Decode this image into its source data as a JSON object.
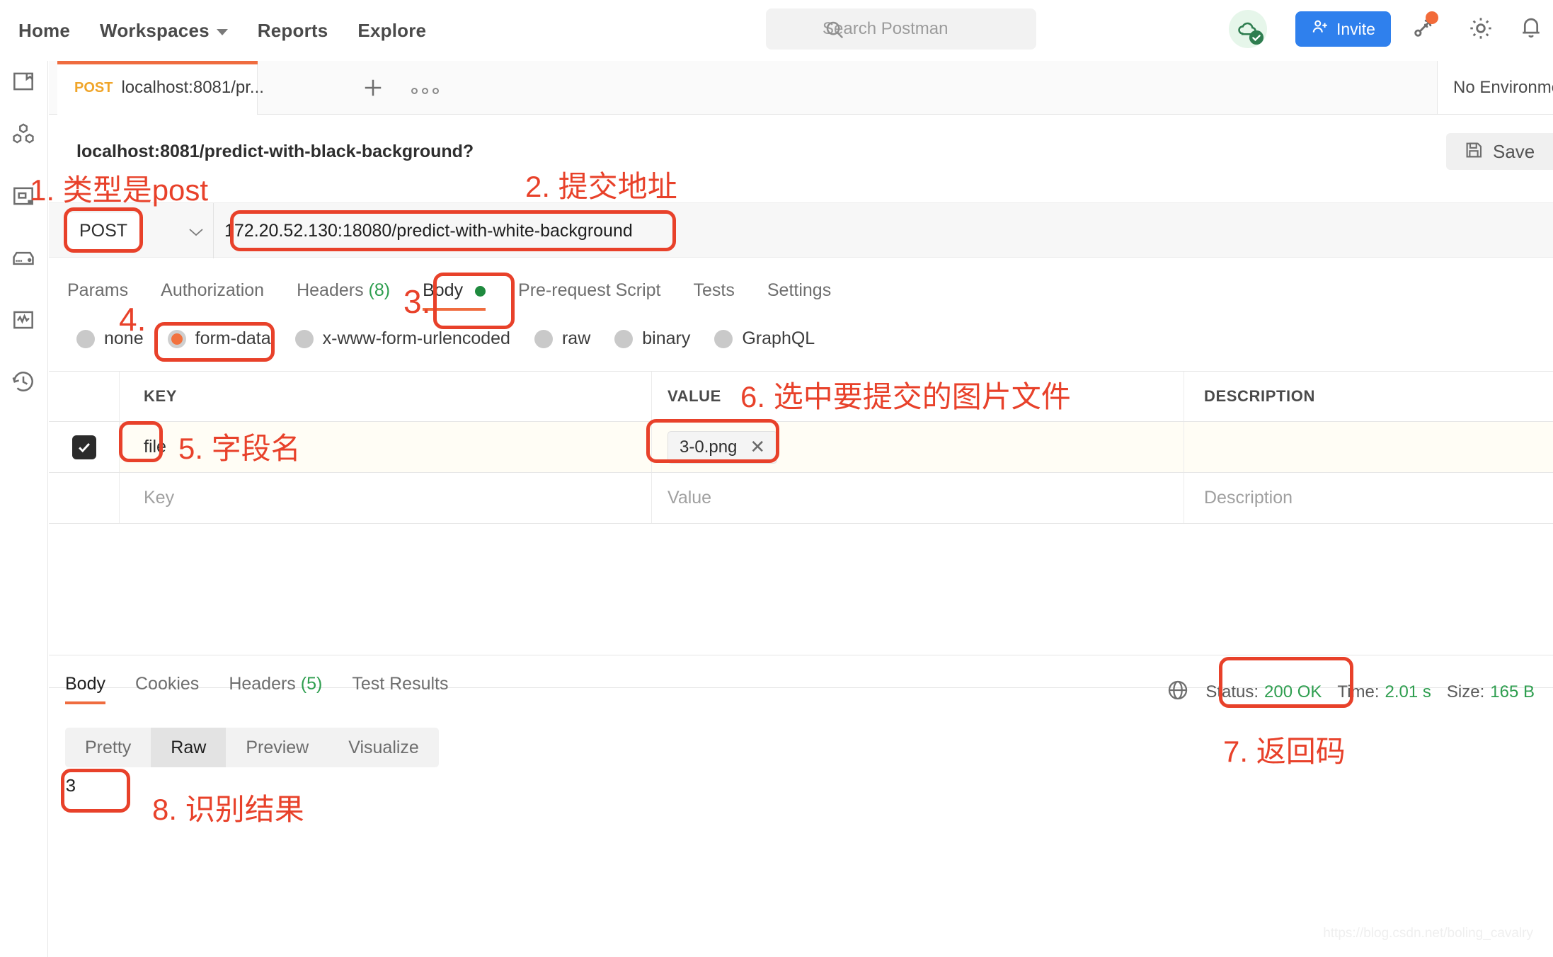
{
  "app": {
    "name": "Postman"
  },
  "header": {
    "nav": [
      {
        "label": "Home",
        "icon": "home-item"
      },
      {
        "label": "Workspaces",
        "icon": "chevron-down-icon"
      },
      {
        "label": "Reports",
        "icon": "reports-item"
      },
      {
        "label": "Explore",
        "icon": "explore-item"
      }
    ],
    "search": {
      "placeholder": "Search Postman",
      "icon": "search-icon"
    },
    "cloud_icon": "cloud-sync-ok-icon",
    "invite": {
      "label": "Invite",
      "icon": "person-add-icon",
      "color": "#2f80ed"
    },
    "broadcast_icon": "broadcast-icon",
    "settings_icon": "gear-icon",
    "notifications_icon": "bell-icon"
  },
  "sidebar": {
    "items": [
      {
        "name": "collections",
        "icon": "collections-folder-icon"
      },
      {
        "name": "apis",
        "icon": "apis-hexagons-icon"
      },
      {
        "name": "environments",
        "icon": "environments-box-icon"
      },
      {
        "name": "mock-servers",
        "icon": "mock-server-icon"
      },
      {
        "name": "monitors",
        "icon": "monitor-pulse-icon"
      },
      {
        "name": "history",
        "icon": "history-clock-icon"
      }
    ]
  },
  "tabstrip": {
    "tab": {
      "method": "POST",
      "title": "localhost:8081/pr...",
      "dirty": true
    },
    "new_tab_icon": "plus-icon",
    "more_icon": "more-horizontal-icon",
    "environment_selector": "No Environme"
  },
  "request": {
    "breadcrumb_title": "localhost:8081/predict-with-black-background?",
    "save_label": "Save",
    "save_icon": "floppy-disk-icon",
    "method": "POST",
    "url": "172.20.52.130:18080/predict-with-white-background",
    "tabs": [
      {
        "label": "Params",
        "active": false
      },
      {
        "label": "Authorization",
        "active": false
      },
      {
        "label": "Headers",
        "count": "(8)",
        "active": false
      },
      {
        "label": "Body",
        "active": true,
        "dot": true
      },
      {
        "label": "Pre-request Script",
        "active": false
      },
      {
        "label": "Tests",
        "active": false
      },
      {
        "label": "Settings",
        "active": false
      }
    ],
    "body_types": [
      {
        "label": "none",
        "selected": false
      },
      {
        "label": "form-data",
        "selected": true
      },
      {
        "label": "x-www-form-urlencoded",
        "selected": false
      },
      {
        "label": "raw",
        "selected": false
      },
      {
        "label": "binary",
        "selected": false
      },
      {
        "label": "GraphQL",
        "selected": false
      }
    ],
    "table": {
      "columns": [
        "KEY",
        "VALUE",
        "DESCRIPTION"
      ],
      "rows": [
        {
          "checked": true,
          "key": "file",
          "value_file": "3-0.png",
          "description": ""
        }
      ],
      "placeholders": {
        "key": "Key",
        "value": "Value",
        "description": "Description"
      }
    }
  },
  "response": {
    "tabs": [
      {
        "label": "Body",
        "active": true
      },
      {
        "label": "Cookies",
        "active": false
      },
      {
        "label": "Headers",
        "count": "(5)",
        "active": false
      },
      {
        "label": "Test Results",
        "active": false
      }
    ],
    "views": [
      {
        "label": "Pretty",
        "active": false
      },
      {
        "label": "Raw",
        "active": true
      },
      {
        "label": "Preview",
        "active": false
      },
      {
        "label": "Visualize",
        "active": false
      }
    ],
    "body": "3",
    "meta": {
      "globe_icon": "globe-icon",
      "status_label": "Status:",
      "status_value": "200 OK",
      "time_label": "Time:",
      "time_value": "2.01 s",
      "size_label": "Size:",
      "size_value": "165 B"
    }
  },
  "annotations": {
    "color": "#e8412a",
    "items": [
      {
        "id": "1",
        "text": "1. 类型是post"
      },
      {
        "id": "2",
        "text": "2. 提交地址"
      },
      {
        "id": "3",
        "text": "3."
      },
      {
        "id": "4",
        "text": "4."
      },
      {
        "id": "5",
        "text": "5. 字段名"
      },
      {
        "id": "6",
        "text": "6. 选中要提交的图片文件"
      },
      {
        "id": "7",
        "text": "7. 返回码"
      },
      {
        "id": "8",
        "text": "8. 识别结果"
      }
    ]
  },
  "watermark": "https://blog.csdn.net/boling_cavalry"
}
